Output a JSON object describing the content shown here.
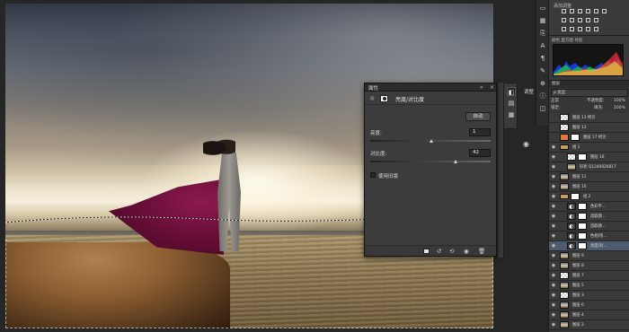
{
  "properties_panel": {
    "tab_label": "属性",
    "adjustment_title": "亮度/对比度",
    "auto_button": "自动",
    "brightness_label": "亮度:",
    "brightness_value": "1",
    "contrast_label": "对比度:",
    "contrast_value": "42",
    "legacy_label": "使用旧版",
    "brightness_fraction": 0.51,
    "contrast_fraction": 0.71
  },
  "collapsed_panels": {
    "panel_label": "调整"
  },
  "adjustments_panel": {
    "title": "添加调整"
  },
  "histogram_panel": {
    "tabs": "颜色 直方图 导航"
  },
  "layers_panel": {
    "tabs": "图层",
    "filter_label": "ρ 类型",
    "blend_mode": "正常",
    "opacity_label": "不透明度:",
    "opacity_value": "100%",
    "lock_label": "锁定:",
    "fill_label": "填充:",
    "fill_value": "100%",
    "layers": [
      {
        "name": "图层 13 拷贝",
        "thumb": "checker",
        "mask": false,
        "visible": false,
        "indent": 0
      },
      {
        "name": "图层 13",
        "thumb": "checker",
        "mask": false,
        "visible": false,
        "indent": 0
      },
      {
        "name": "图层 17 拷贝",
        "thumb": "orange",
        "mask": true,
        "visible": false,
        "indent": 0
      },
      {
        "name": "组 1",
        "thumb": "group",
        "mask": false,
        "visible": true,
        "indent": 0
      },
      {
        "name": "图层 16",
        "thumb": "checker",
        "mask": true,
        "visible": true,
        "indent": 1
      },
      {
        "name": "形状 Q1240826817",
        "thumb": "photo",
        "mask": false,
        "visible": true,
        "indent": 1
      },
      {
        "name": "图层 11",
        "thumb": "photo",
        "mask": false,
        "visible": true,
        "indent": 0
      },
      {
        "name": "图层 10",
        "thumb": "photo",
        "mask": false,
        "visible": true,
        "indent": 0
      },
      {
        "name": "组 2",
        "thumb": "group",
        "mask": true,
        "visible": true,
        "indent": 0
      },
      {
        "name": "色彩平...",
        "thumb": "adj",
        "mask": true,
        "visible": true,
        "indent": 1
      },
      {
        "name": "选取颜...",
        "thumb": "adj",
        "mask": true,
        "visible": true,
        "indent": 1
      },
      {
        "name": "选取颜...",
        "thumb": "adj",
        "mask": true,
        "visible": true,
        "indent": 1
      },
      {
        "name": "色相/饱...",
        "thumb": "adj",
        "mask": true,
        "visible": true,
        "indent": 1
      },
      {
        "name": "亮度/对...",
        "thumb": "adj",
        "mask": true,
        "visible": true,
        "indent": 1,
        "selected": true
      },
      {
        "name": "图层 9",
        "thumb": "photo",
        "mask": false,
        "visible": true,
        "indent": 0
      },
      {
        "name": "图层 8",
        "thumb": "photo",
        "mask": false,
        "visible": true,
        "indent": 0
      },
      {
        "name": "图层 7",
        "thumb": "checker",
        "mask": false,
        "visible": true,
        "indent": 0
      },
      {
        "name": "图层 5",
        "thumb": "photo",
        "mask": false,
        "visible": true,
        "indent": 0
      },
      {
        "name": "图层 3",
        "thumb": "checker",
        "mask": false,
        "visible": true,
        "indent": 0
      },
      {
        "name": "图层 6",
        "thumb": "photo",
        "mask": false,
        "visible": true,
        "indent": 0
      },
      {
        "name": "图层 4",
        "thumb": "photo",
        "mask": false,
        "visible": true,
        "indent": 0
      },
      {
        "name": "图层 2",
        "thumb": "photo",
        "mask": false,
        "visible": true,
        "indent": 0
      }
    ]
  },
  "colors": {
    "panel_bg": "#3c3c3c",
    "dock_bg": "#343434",
    "selected_layer": "#4e5a6e",
    "dress": "#6a0e38"
  }
}
